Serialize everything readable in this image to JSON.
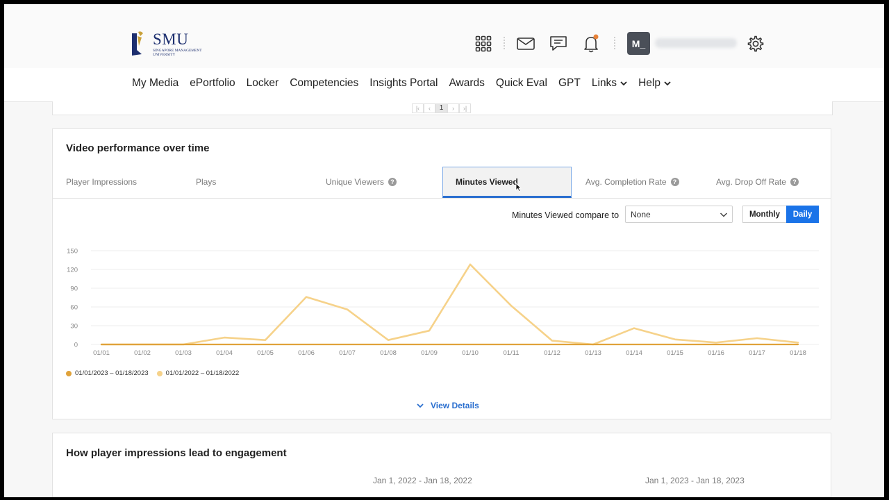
{
  "header": {
    "logo": {
      "name": "SMU",
      "subline": "SINGAPORE MANAGEMENT UNIVERSITY"
    },
    "icons": [
      "apps-grid-icon",
      "mail-icon",
      "chat-icon",
      "bell-icon",
      "settings-icon"
    ],
    "notification_dot_color": "#e8833a",
    "avatar_initials": "M_"
  },
  "nav": {
    "links": [
      "My Media",
      "ePortfolio",
      "Locker",
      "Competencies",
      "Insights Portal",
      "Awards",
      "Quick Eval",
      "GPT",
      "Links",
      "Help"
    ],
    "dropdown_links": [
      "Links",
      "Help"
    ]
  },
  "pager": {
    "current_page": "1"
  },
  "video_performance": {
    "title": "Video performance over time",
    "tabs": [
      {
        "label": "Player Impressions",
        "help": false,
        "active": false
      },
      {
        "label": "Plays",
        "help": false,
        "active": false
      },
      {
        "label": "Unique Viewers",
        "help": true,
        "active": false
      },
      {
        "label": "Minutes Viewed",
        "help": false,
        "active": true
      },
      {
        "label": "Avg. Completion Rate",
        "help": true,
        "active": false
      },
      {
        "label": "Avg. Drop Off Rate",
        "help": true,
        "active": false
      }
    ],
    "compare_label": "Minutes Viewed compare to",
    "compare_value": "None",
    "granularity": {
      "monthly": "Monthly",
      "daily": "Daily",
      "selected": "Daily"
    },
    "view_details": "View Details"
  },
  "chart_data": {
    "type": "line",
    "x": [
      "01/01",
      "01/02",
      "01/03",
      "01/04",
      "01/05",
      "01/06",
      "01/07",
      "01/08",
      "01/09",
      "01/10",
      "01/11",
      "01/12",
      "01/13",
      "01/14",
      "01/15",
      "01/16",
      "01/17",
      "01/18"
    ],
    "yticks": [
      0,
      30,
      60,
      90,
      120,
      150
    ],
    "ylim": [
      0,
      150
    ],
    "grid": true,
    "legend_position": "bottom-left",
    "series": [
      {
        "name": "01/01/2023 – 01/18/2023",
        "color": "#e0a23a",
        "values": [
          0,
          0,
          0,
          0,
          0,
          0,
          0,
          0,
          0,
          0,
          0,
          0,
          0,
          0,
          0,
          0,
          0,
          0
        ]
      },
      {
        "name": "01/01/2022 – 01/18/2022",
        "color": "#f6d28a",
        "values": [
          0,
          0,
          0,
          11,
          7,
          76,
          56,
          7,
          22,
          128,
          62,
          6,
          0,
          26,
          8,
          3,
          10,
          3
        ]
      }
    ]
  },
  "engagement": {
    "title": "How player impressions lead to engagement",
    "period_a": "Jan 1, 2022 - Jan 18, 2022",
    "period_b": "Jan 1, 2023 - Jan 18, 2023"
  }
}
